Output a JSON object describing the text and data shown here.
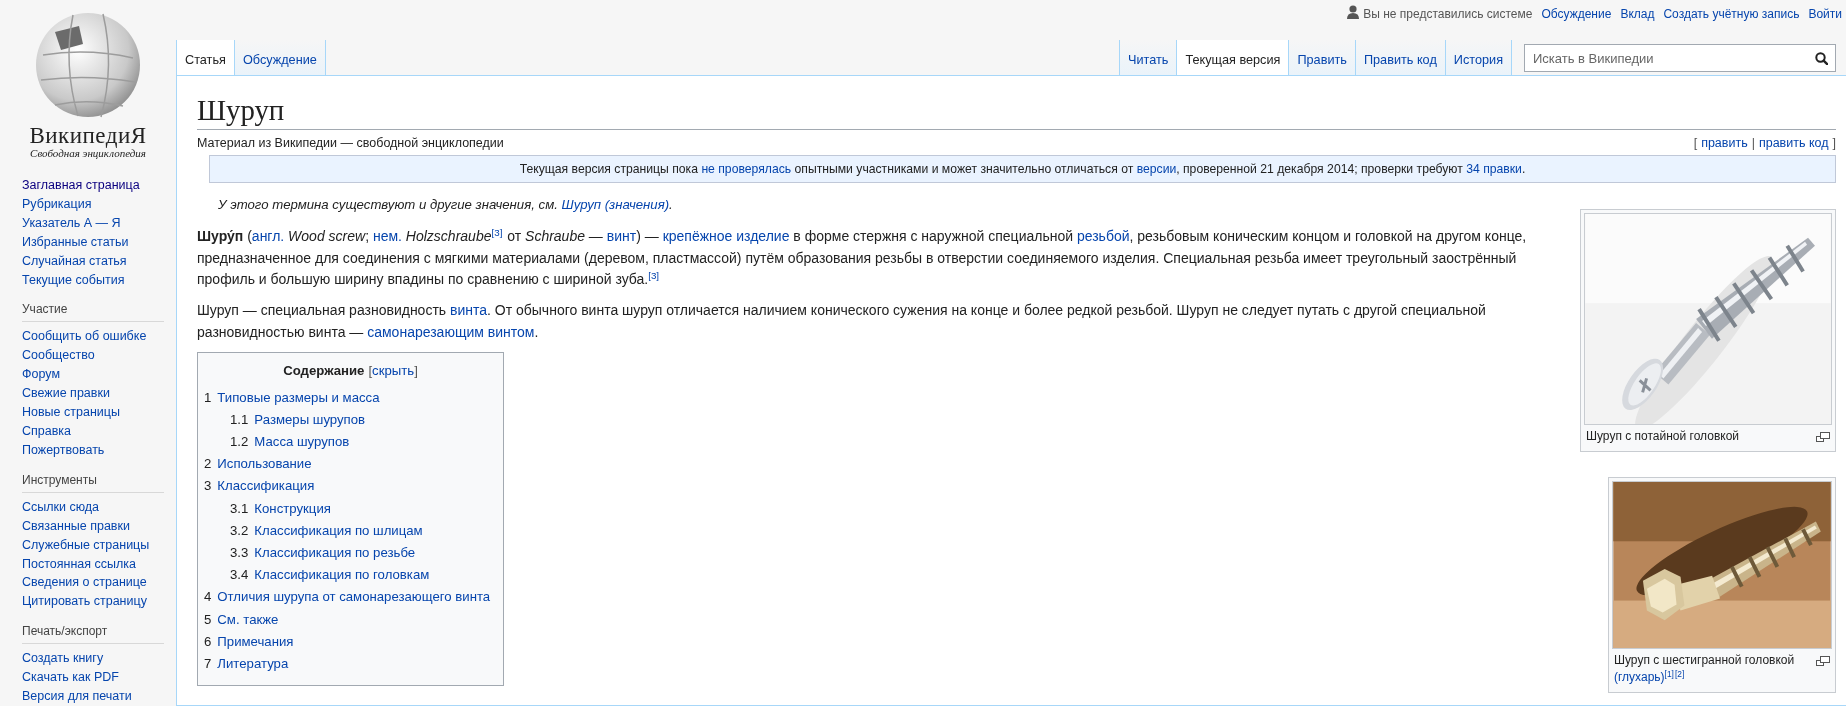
{
  "logo": {
    "wordmark": "ВикипедиЯ",
    "tagline": "Свободная энциклопедия"
  },
  "sidebar": {
    "sections": [
      {
        "items": [
          {
            "label": "Заглавная страница",
            "visited": true
          },
          {
            "label": "Рубрикация",
            "visited": false
          },
          {
            "label": "Указатель А — Я",
            "visited": false
          },
          {
            "label": "Избранные статьи",
            "visited": false
          },
          {
            "label": "Случайная статья",
            "visited": false
          },
          {
            "label": "Текущие события",
            "visited": false
          }
        ]
      },
      {
        "heading": "Участие",
        "items": [
          {
            "label": "Сообщить об ошибке",
            "visited": false
          },
          {
            "label": "Сообщество",
            "visited": false
          },
          {
            "label": "Форум",
            "visited": false
          },
          {
            "label": "Свежие правки",
            "visited": false
          },
          {
            "label": "Новые страницы",
            "visited": false
          },
          {
            "label": "Справка",
            "visited": false
          },
          {
            "label": "Пожертвовать",
            "visited": false
          }
        ]
      },
      {
        "heading": "Инструменты",
        "items": [
          {
            "label": "Ссылки сюда",
            "visited": false
          },
          {
            "label": "Связанные правки",
            "visited": false
          },
          {
            "label": "Служебные страницы",
            "visited": false
          },
          {
            "label": "Постоянная ссылка",
            "visited": false
          },
          {
            "label": "Сведения о странице",
            "visited": false
          },
          {
            "label": "Цитировать страницу",
            "visited": false
          }
        ]
      },
      {
        "heading": "Печать/экспорт",
        "items": [
          {
            "label": "Создать книгу",
            "visited": false
          },
          {
            "label": "Скачать как PDF",
            "visited": false
          },
          {
            "label": "Версия для печати",
            "visited": false
          }
        ]
      }
    ]
  },
  "personal_tools": {
    "anon_label": "Вы не представились системе",
    "links": [
      "Обсуждение",
      "Вклад",
      "Создать учётную запись",
      "Войти"
    ]
  },
  "namespace_tabs": [
    {
      "label": "Статья",
      "selected": true
    },
    {
      "label": "Обсуждение",
      "selected": false
    }
  ],
  "view_tabs": [
    {
      "label": "Читать",
      "selected": false
    },
    {
      "label": "Текущая версия",
      "selected": true
    },
    {
      "label": "Править",
      "selected": false
    },
    {
      "label": "Править код",
      "selected": false
    },
    {
      "label": "История",
      "selected": false
    }
  ],
  "search": {
    "placeholder": "Искать в Википедии"
  },
  "article": {
    "title": "Шуруп",
    "tagline": "Материал из Википедии — свободной энциклопедии",
    "edit_links": {
      "open": "[",
      "links": [
        "править",
        "править код"
      ],
      "separator": "|",
      "close": "]"
    },
    "notice": [
      {
        "kind": "text",
        "text": "Текущая версия страницы пока "
      },
      {
        "kind": "link",
        "text": "не проверялась"
      },
      {
        "kind": "text",
        "text": " опытными участниками и может значительно отличаться от "
      },
      {
        "kind": "link",
        "text": "версии"
      },
      {
        "kind": "text",
        "text": ", проверенной 21 декабря 2014; проверки требуют "
      },
      {
        "kind": "link",
        "text": "34 правки"
      },
      {
        "kind": "text",
        "text": "."
      }
    ],
    "hatnote": [
      {
        "kind": "text",
        "text": "У этого термина существуют и другие значения, см. "
      },
      {
        "kind": "link",
        "text": "Шуруп (значения)"
      },
      {
        "kind": "text",
        "text": "."
      }
    ],
    "paragraphs": [
      [
        {
          "kind": "text",
          "text": "**Шуру́п** ("
        },
        {
          "kind": "link",
          "text": "англ."
        },
        {
          "kind": "text",
          "text": " *Wood screw*; "
        },
        {
          "kind": "link",
          "text": "нем."
        },
        {
          "kind": "text",
          "text": " *Holzschraube*"
        },
        {
          "kind": "ref",
          "text": "[3]"
        },
        {
          "kind": "text",
          "text": " от *Schraube* — "
        },
        {
          "kind": "link",
          "text": "винт"
        },
        {
          "kind": "text",
          "text": ") — "
        },
        {
          "kind": "link",
          "text": "крепёжное изделие"
        },
        {
          "kind": "text",
          "text": " в форме стержня с наружной специальной "
        },
        {
          "kind": "link",
          "text": "резьбой"
        },
        {
          "kind": "text",
          "text": ", резьбовым коническим концом и головкой на другом конце, предназначенное для соединения с мягкими материалами (деревом, пластмассой) путём образования резьбы в отверстии соединяемого изделия. Специальная резьба имеет треугольный заострённый профиль и большую ширину впадины по сравнению с шириной зуба."
        },
        {
          "kind": "ref",
          "text": "[3]"
        }
      ],
      [
        {
          "kind": "text",
          "text": "Шуруп — специальная разновидность "
        },
        {
          "kind": "link",
          "text": "винта"
        },
        {
          "kind": "text",
          "text": ". От обычного винта шуруп отличается наличием конического сужения на конце и более редкой резьбой. Шуруп не следует путать с другой специальной разновидностью винта — "
        },
        {
          "kind": "link",
          "text": "самонарезающим винтом"
        },
        {
          "kind": "text",
          "text": "."
        }
      ]
    ],
    "toc": {
      "title": "Содержание",
      "toggle": {
        "open": "[",
        "link": "скрыть",
        "close": "]"
      },
      "items": [
        {
          "number": "1",
          "label": "Типовые размеры и масса",
          "children": [
            {
              "number": "1.1",
              "label": "Размеры шурупов"
            },
            {
              "number": "1.2",
              "label": "Масса шурупов"
            }
          ]
        },
        {
          "number": "2",
          "label": "Использование"
        },
        {
          "number": "3",
          "label": "Классификация",
          "children": [
            {
              "number": "3.1",
              "label": "Конструкция"
            },
            {
              "number": "3.2",
              "label": "Классификация по шлицам"
            },
            {
              "number": "3.3",
              "label": "Классификация по резьбе"
            },
            {
              "number": "3.4",
              "label": "Классификация по головкам"
            }
          ]
        },
        {
          "number": "4",
          "label": "Отличия шурупа от самонарезающего винта"
        },
        {
          "number": "5",
          "label": "См. также"
        },
        {
          "number": "6",
          "label": "Примечания"
        },
        {
          "number": "7",
          "label": "Литература"
        }
      ]
    },
    "thumbnails": [
      {
        "caption": [
          {
            "kind": "text",
            "text": "Шуруп с потайной головкой"
          }
        ]
      },
      {
        "caption": [
          {
            "kind": "text",
            "text": "Шуруп с шестигранной головкой "
          },
          {
            "kind": "link",
            "text": "(глухарь)"
          },
          {
            "kind": "ref",
            "text": "[1]"
          },
          {
            "kind": "ref",
            "text": "[2]"
          }
        ]
      }
    ]
  }
}
